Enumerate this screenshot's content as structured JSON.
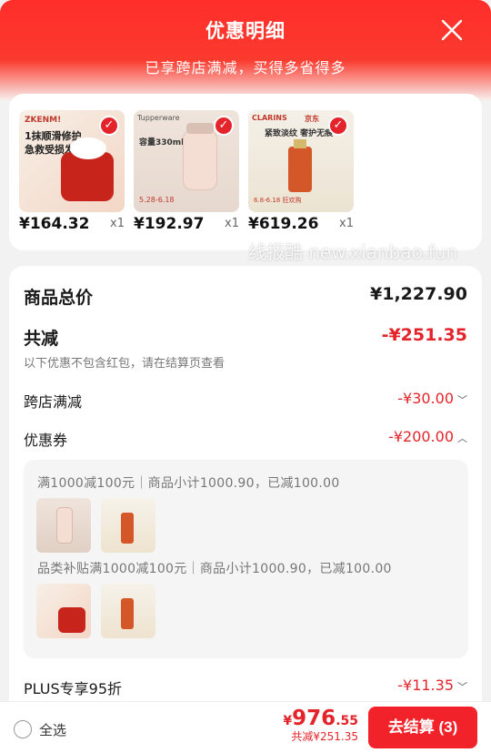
{
  "header": {
    "title": "优惠明细",
    "subtitle": "已享跨店满减，买得多省得多"
  },
  "watermark": "线报酷 new.xianbao.fun",
  "products": [
    {
      "price": "¥164.32",
      "qty": "x1",
      "img_text": [
        "ZKENM!",
        "1抹顺滑修护",
        "急救受损发质"
      ]
    },
    {
      "price": "¥192.97",
      "qty": "x1",
      "img_text": [
        "Tupperware",
        "容量330ml",
        "5.28-6.18"
      ]
    },
    {
      "price": "¥619.26",
      "qty": "x1",
      "img_text": [
        "CLARINS",
        "京东",
        "紧致淡纹 奢护无痕",
        "6.8-6.18 狂欢购"
      ]
    }
  ],
  "summary": {
    "total_label": "商品总价",
    "total_value": "¥1,227.90",
    "reduce_label": "共减",
    "reduce_value": "-¥251.35",
    "reduce_note": "以下优惠不包含红包，请在结算页查看",
    "cross_store_label": "跨店满减",
    "cross_store_value": "-¥30.00",
    "coupon_label": "优惠券",
    "coupon_value": "-¥200.00",
    "coupon_line1": "满1000减100元｜商品小计1000.90，已减100.00",
    "coupon_line2": "品类补贴满1000减100元｜商品小计1000.90，已减100.00",
    "plus_label": "PLUS专享95折",
    "plus_value": "-¥11.35"
  },
  "footer": {
    "select_all": "全选",
    "yen": "¥",
    "price_int": "976",
    "price_dec": ".55",
    "saved": "共减¥251.35",
    "checkout": "去结算 (3)"
  },
  "colors": {
    "accent": "#e3242b",
    "header": "#ff2e2a"
  }
}
